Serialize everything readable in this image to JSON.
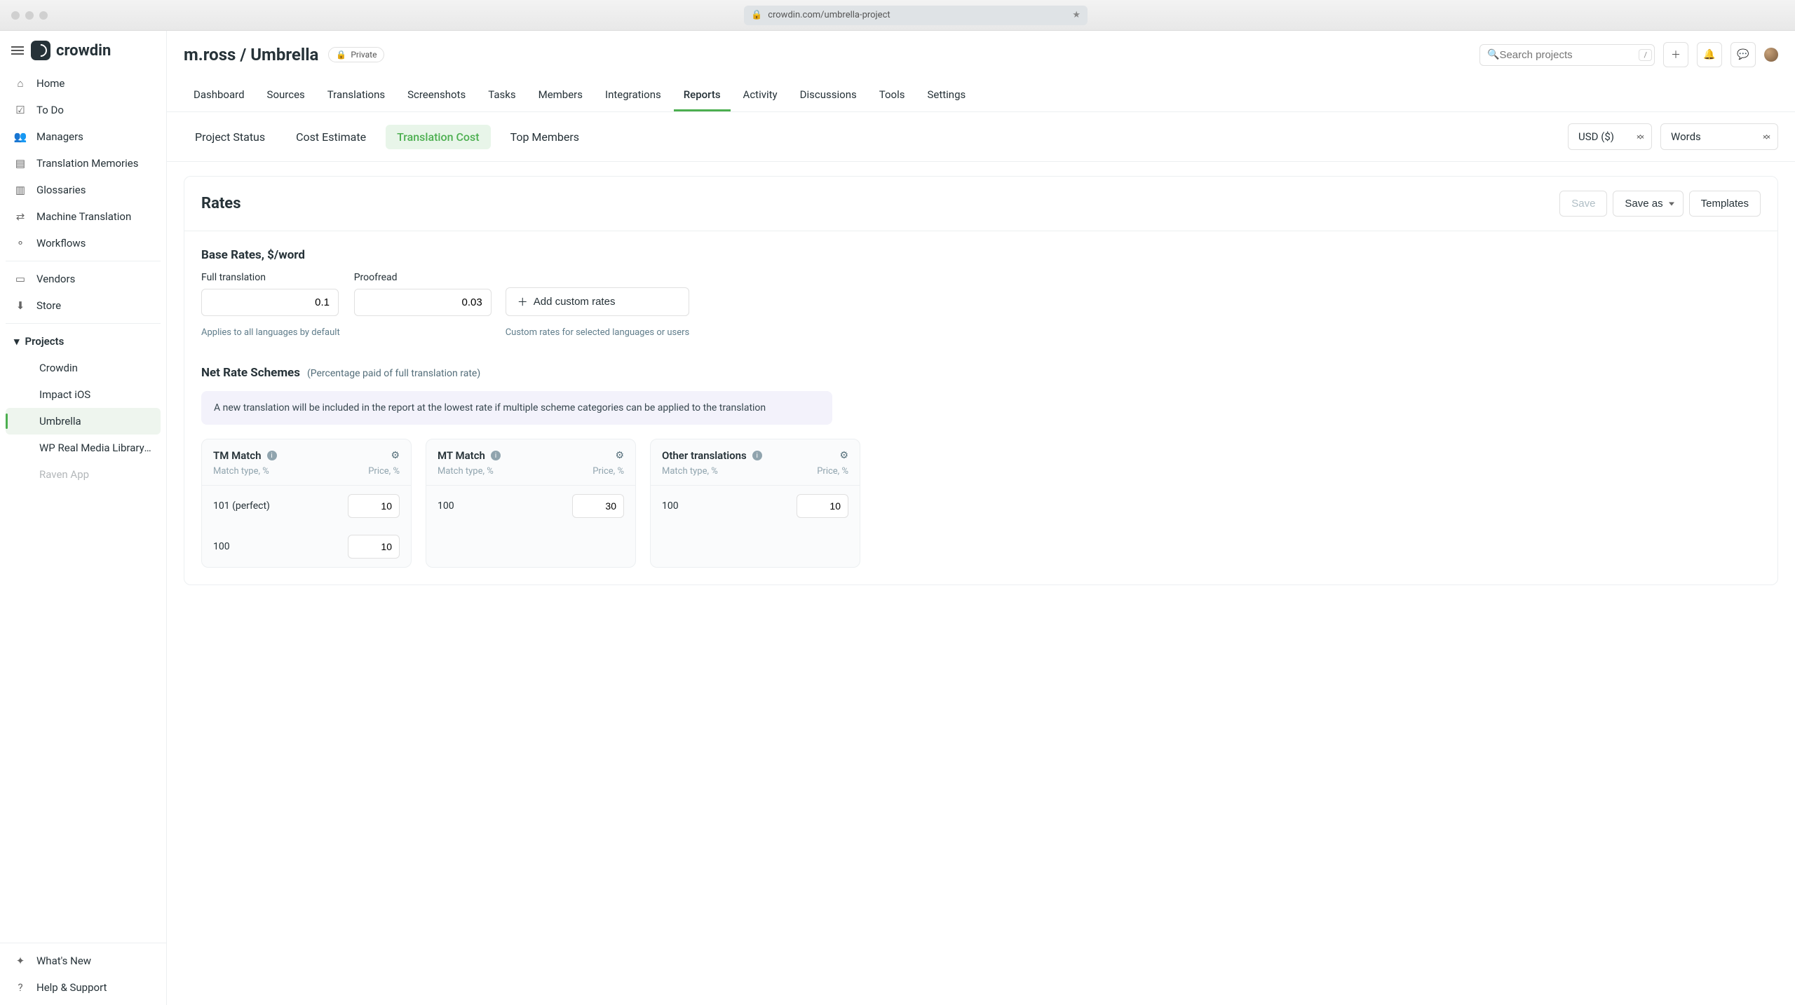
{
  "browser": {
    "url": "crowdin.com/umbrella-project"
  },
  "logo_text": "crowdin",
  "sidebar": {
    "items": [
      {
        "label": "Home"
      },
      {
        "label": "To Do"
      },
      {
        "label": "Managers"
      },
      {
        "label": "Translation Memories"
      },
      {
        "label": "Glossaries"
      },
      {
        "label": "Machine Translation"
      },
      {
        "label": "Workflows"
      },
      {
        "label": "Vendors"
      },
      {
        "label": "Store"
      }
    ],
    "projects_label": "Projects",
    "projects": [
      {
        "label": "Crowdin"
      },
      {
        "label": "Impact iOS"
      },
      {
        "label": "Umbrella"
      },
      {
        "label": "WP Real Media Library (un…"
      },
      {
        "label": "Raven App"
      }
    ],
    "footer": [
      {
        "label": "What's New"
      },
      {
        "label": "Help & Support"
      }
    ]
  },
  "header": {
    "breadcrumb": "m.ross / Umbrella",
    "badge": "Private",
    "search_placeholder": "Search projects",
    "search_shortcut": "/"
  },
  "tabs": [
    "Dashboard",
    "Sources",
    "Translations",
    "Screenshots",
    "Tasks",
    "Members",
    "Integrations",
    "Reports",
    "Activity",
    "Discussions",
    "Tools",
    "Settings"
  ],
  "active_tab": "Reports",
  "subtabs": [
    "Project Status",
    "Cost Estimate",
    "Translation Cost",
    "Top Members"
  ],
  "active_subtab": "Translation Cost",
  "selectors": {
    "currency": "USD ($)",
    "unit": "Words"
  },
  "rates_panel": {
    "title": "Rates",
    "save": "Save",
    "save_as": "Save as",
    "templates": "Templates",
    "base_rates_title": "Base Rates, $/word",
    "full_translation_label": "Full translation",
    "full_translation_value": "0.1",
    "proofread_label": "Proofread",
    "proofread_value": "0.03",
    "add_custom": "Add custom rates",
    "base_hint": "Applies to all languages by default",
    "custom_hint": "Custom rates for selected languages or users",
    "schemes_title": "Net Rate Schemes",
    "schemes_sub": "(Percentage paid of full translation rate)",
    "banner": "A new translation will be included in the report at the lowest rate if multiple scheme categories can be applied to the translation",
    "col_match": "Match type, %",
    "col_price": "Price, %",
    "cards": [
      {
        "title": "TM Match",
        "rows": [
          {
            "label": "101 (perfect)",
            "value": "10"
          },
          {
            "label": "100",
            "value": "10"
          }
        ]
      },
      {
        "title": "MT Match",
        "rows": [
          {
            "label": "100",
            "value": "30"
          }
        ]
      },
      {
        "title": "Other translations",
        "rows": [
          {
            "label": "100",
            "value": "10"
          }
        ]
      }
    ]
  }
}
